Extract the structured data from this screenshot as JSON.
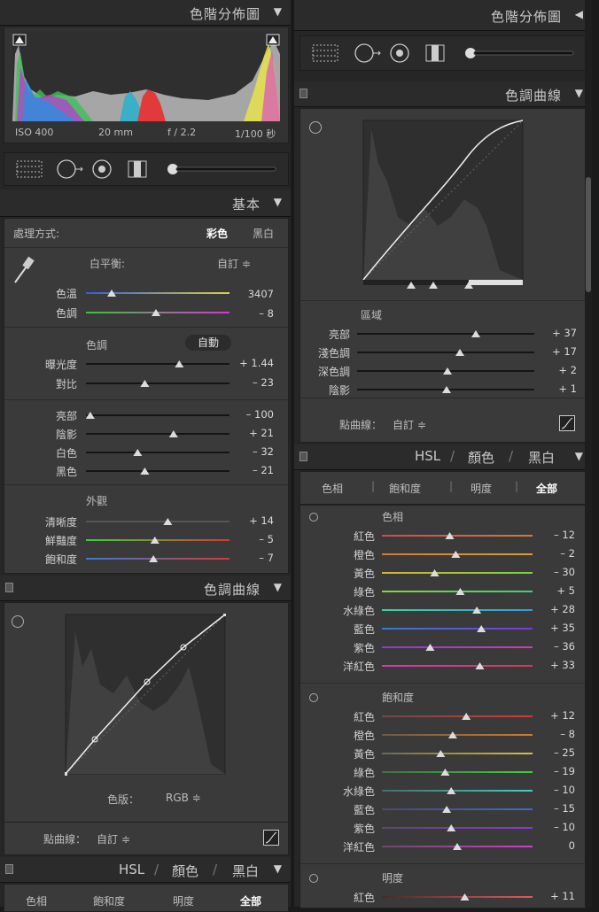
{
  "left": {
    "histogram": {
      "title": "色階分佈圖",
      "iso": "ISO 400",
      "focal": "20 mm",
      "aperture": "f / 2.2",
      "shutter": "1/100 秒"
    },
    "basic": {
      "title": "基本",
      "treatment_label": "處理方式:",
      "treatment_color": "彩色",
      "treatment_bw": "黑白",
      "wb_label": "白平衡:",
      "wb_value": "自訂 ≑",
      "temp_label": "色溫",
      "temp_value": "3407",
      "tint_label": "色調",
      "tint_value": "– 8",
      "tone_label": "色調",
      "auto_label": "自動",
      "sliders_tone": [
        {
          "label": "曝光度",
          "value": "+ 1.44",
          "pos": 0.65
        },
        {
          "label": "對比",
          "value": "– 23",
          "pos": 0.41
        }
      ],
      "sliders_light": [
        {
          "label": "亮部",
          "value": "– 100",
          "pos": 0.03
        },
        {
          "label": "陰影",
          "value": "+ 21",
          "pos": 0.61
        },
        {
          "label": "白色",
          "value": "– 32",
          "pos": 0.36
        },
        {
          "label": "黑色",
          "value": "– 21",
          "pos": 0.41
        }
      ],
      "presence_label": "外觀",
      "sliders_presence": [
        {
          "label": "清晰度",
          "value": "+ 14",
          "pos": 0.57
        },
        {
          "label": "鮮豔度",
          "value": "– 5",
          "pos": 0.48
        },
        {
          "label": "飽和度",
          "value": "– 7",
          "pos": 0.47
        }
      ]
    },
    "curve": {
      "title": "色調曲線",
      "channel_label": "色版：",
      "channel_value": "RGB ≑",
      "point_curve_label": "點曲線：",
      "point_curve_value": "自訂 ≑"
    },
    "hsl": {
      "title_hsl": "HSL",
      "title_color": "顏色",
      "title_bw": "黑白",
      "tabs": [
        "色相",
        "飽和度",
        "明度",
        "全部"
      ]
    }
  },
  "right": {
    "histogram_title": "色階分佈圖",
    "curve": {
      "title": "色調曲線",
      "region_label": "區域",
      "sliders": [
        {
          "label": "亮部",
          "value": "+ 37",
          "pos": 0.67
        },
        {
          "label": "淺色調",
          "value": "+ 17",
          "pos": 0.58
        },
        {
          "label": "深色調",
          "value": "+ 2",
          "pos": 0.51
        },
        {
          "label": "陰影",
          "value": "+ 1",
          "pos": 0.505
        }
      ],
      "point_curve_label": "點曲線：",
      "point_curve_value": "自訂 ≑"
    },
    "hsl": {
      "title_hsl": "HSL",
      "title_color": "顏色",
      "title_bw": "黑白",
      "tabs": [
        "色相",
        "飽和度",
        "明度",
        "全部"
      ],
      "hue_label": "色相",
      "hue": [
        {
          "label": "紅色",
          "value": "– 12",
          "pos": 0.45
        },
        {
          "label": "橙色",
          "value": "– 2",
          "pos": 0.49
        },
        {
          "label": "黃色",
          "value": "– 30",
          "pos": 0.35
        },
        {
          "label": "綠色",
          "value": "+ 5",
          "pos": 0.52
        },
        {
          "label": "水綠色",
          "value": "+ 28",
          "pos": 0.63
        },
        {
          "label": "藍色",
          "value": "+ 35",
          "pos": 0.66
        },
        {
          "label": "紫色",
          "value": "– 36",
          "pos": 0.32
        },
        {
          "label": "洋紅色",
          "value": "+ 33",
          "pos": 0.65
        }
      ],
      "sat_label": "飽和度",
      "sat": [
        {
          "label": "紅色",
          "value": "+ 12",
          "pos": 0.56
        },
        {
          "label": "橙色",
          "value": "– 8",
          "pos": 0.47
        },
        {
          "label": "黃色",
          "value": "– 25",
          "pos": 0.39
        },
        {
          "label": "綠色",
          "value": "– 19",
          "pos": 0.42
        },
        {
          "label": "水綠色",
          "value": "– 10",
          "pos": 0.46
        },
        {
          "label": "藍色",
          "value": "– 15",
          "pos": 0.43
        },
        {
          "label": "紫色",
          "value": "– 10",
          "pos": 0.46
        },
        {
          "label": "洋紅色",
          "value": "0",
          "pos": 0.5
        }
      ],
      "lum_label": "明度",
      "lum": [
        {
          "label": "紅色",
          "value": "+ 11",
          "pos": 0.55
        }
      ]
    }
  },
  "colors": {
    "panel": "#3a3a3a",
    "header": "#2b2b2b",
    "text": "#cfcfcf"
  }
}
